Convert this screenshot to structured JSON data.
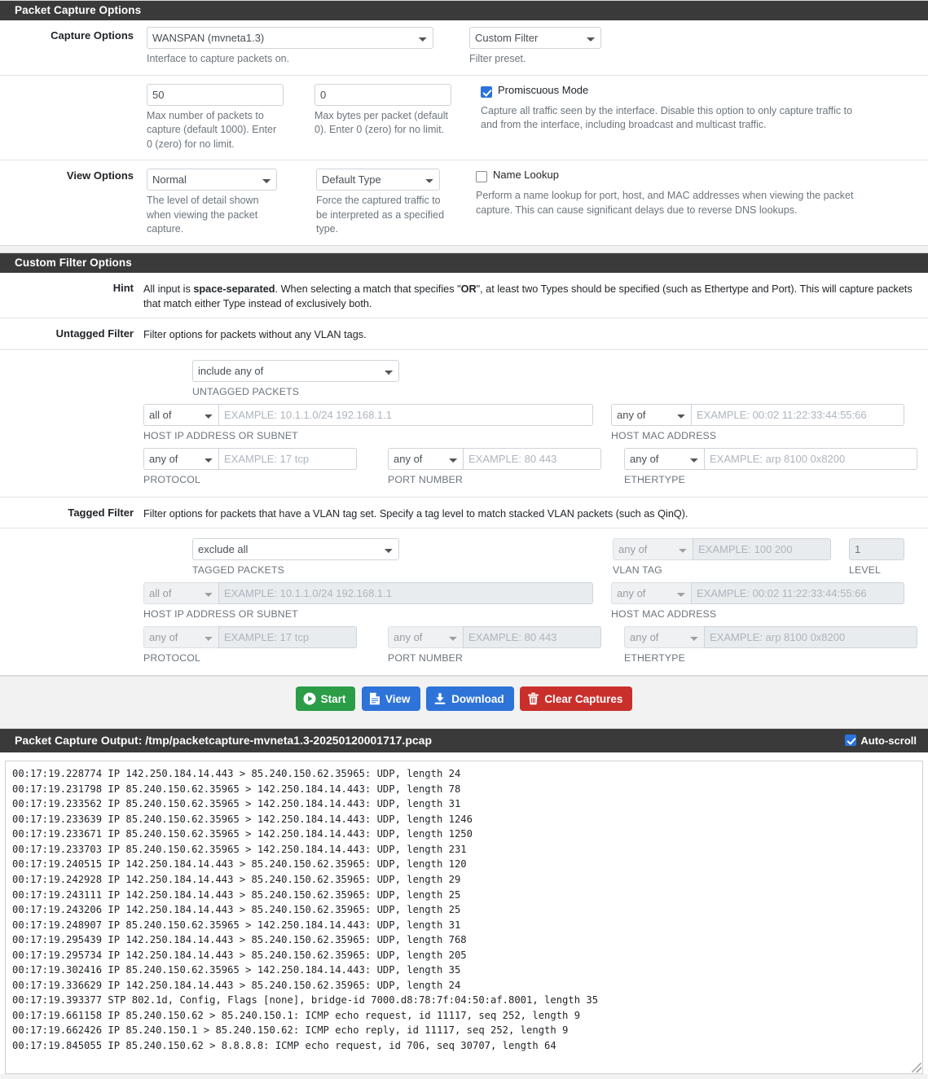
{
  "capture_panel": {
    "title": "Packet Capture Options",
    "capture_options_label": "Capture Options",
    "interface_value": "WANSPAN (mvneta1.3)",
    "interface_help": "Interface to capture packets on.",
    "filter_preset_value": "Custom Filter",
    "filter_preset_help": "Filter preset.",
    "max_packets_value": "50",
    "max_packets_help": "Max number of packets to capture (default 1000). Enter 0 (zero) for no limit.",
    "max_bytes_value": "0",
    "max_bytes_help": "Max bytes per packet (default 0). Enter 0 (zero) for no limit.",
    "promiscuous_label": "Promiscuous Mode",
    "promiscuous_checked": true,
    "promiscuous_help": "Capture all traffic seen by the interface. Disable this option to only capture traffic to and from the interface, including broadcast and multicast traffic.",
    "view_options_label": "View Options",
    "detail_level_value": "Normal",
    "detail_level_help": "The level of detail shown when viewing the packet capture.",
    "packet_type_value": "Default Type",
    "packet_type_help": "Force the captured traffic to be interpreted as a specified type.",
    "name_lookup_label": "Name Lookup",
    "name_lookup_checked": false,
    "name_lookup_help": "Perform a name lookup for port, host, and MAC addresses when viewing the packet capture. This can cause significant delays due to reverse DNS lookups."
  },
  "filter_panel": {
    "title": "Custom Filter Options",
    "hint_label": "Hint",
    "hint_part1": "All input is ",
    "hint_bold1": "space-separated",
    "hint_part2": ". When selecting a match that specifies \"",
    "hint_bold2": "OR",
    "hint_part3": "\", at least two Types should be specified (such as Ethertype and Port). This will capture packets that match either Type instead of exclusively both.",
    "untagged_label": "Untagged Filter",
    "untagged_desc": "Filter options for packets without any VLAN tags.",
    "tagged_label": "Tagged Filter",
    "tagged_desc": "Filter options for packets that have a VLAN tag set. Specify a tag level to match stacked VLAN packets (such as QinQ).",
    "untagged": {
      "mode_value": "include any of",
      "mode_caption": "UNTAGGED PACKETS",
      "host_ip_match": "all of",
      "host_ip_placeholder": "EXAMPLE: 10.1.1.0/24 192.168.1.1",
      "host_ip_caption": "HOST IP ADDRESS OR SUBNET",
      "host_mac_match": "any of",
      "host_mac_placeholder": "EXAMPLE: 00:02 11:22:33:44:55:66",
      "host_mac_caption": "HOST MAC ADDRESS",
      "protocol_match": "any of",
      "protocol_placeholder": "EXAMPLE: 17 tcp",
      "protocol_caption": "PROTOCOL",
      "port_match": "any of",
      "port_placeholder": "EXAMPLE: 80 443",
      "port_caption": "PORT NUMBER",
      "ethertype_match": "any of",
      "ethertype_placeholder": "EXAMPLE: arp 8100 0x8200",
      "ethertype_caption": "ETHERTYPE"
    },
    "tagged": {
      "mode_value": "exclude all",
      "mode_caption": "TAGGED PACKETS",
      "vlan_match": "any of",
      "vlan_placeholder": "EXAMPLE: 100 200",
      "vlan_caption": "VLAN TAG",
      "level_value": "1",
      "level_caption": "LEVEL",
      "host_ip_match": "all of",
      "host_ip_placeholder": "EXAMPLE: 10.1.1.0/24 192.168.1.1",
      "host_ip_caption": "HOST IP ADDRESS OR SUBNET",
      "host_mac_match": "any of",
      "host_mac_placeholder": "EXAMPLE: 00:02 11:22:33:44:55:66",
      "host_mac_caption": "HOST MAC ADDRESS",
      "protocol_match": "any of",
      "protocol_placeholder": "EXAMPLE: 17 tcp",
      "protocol_caption": "PROTOCOL",
      "port_match": "any of",
      "port_placeholder": "EXAMPLE: 80 443",
      "port_caption": "PORT NUMBER",
      "ethertype_match": "any of",
      "ethertype_placeholder": "EXAMPLE: arp 8100 0x8200",
      "ethertype_caption": "ETHERTYPE"
    }
  },
  "buttons": {
    "start": "Start",
    "view": "View",
    "download": "Download",
    "clear": "Clear Captures"
  },
  "output": {
    "title": "Packet Capture Output: /tmp/packetcapture-mvneta1.3-20250120001717.pcap",
    "autoscroll_label": "Auto-scroll",
    "autoscroll_checked": true,
    "lines": [
      "00:17:19.228774 IP 142.250.184.14.443 > 85.240.150.62.35965: UDP, length 24",
      "00:17:19.231798 IP 85.240.150.62.35965 > 142.250.184.14.443: UDP, length 78",
      "00:17:19.233562 IP 85.240.150.62.35965 > 142.250.184.14.443: UDP, length 31",
      "00:17:19.233639 IP 85.240.150.62.35965 > 142.250.184.14.443: UDP, length 1246",
      "00:17:19.233671 IP 85.240.150.62.35965 > 142.250.184.14.443: UDP, length 1250",
      "00:17:19.233703 IP 85.240.150.62.35965 > 142.250.184.14.443: UDP, length 231",
      "00:17:19.240515 IP 142.250.184.14.443 > 85.240.150.62.35965: UDP, length 120",
      "00:17:19.242928 IP 142.250.184.14.443 > 85.240.150.62.35965: UDP, length 29",
      "00:17:19.243111 IP 142.250.184.14.443 > 85.240.150.62.35965: UDP, length 25",
      "00:17:19.243206 IP 142.250.184.14.443 > 85.240.150.62.35965: UDP, length 25",
      "00:17:19.248907 IP 85.240.150.62.35965 > 142.250.184.14.443: UDP, length 31",
      "00:17:19.295439 IP 142.250.184.14.443 > 85.240.150.62.35965: UDP, length 768",
      "00:17:19.295734 IP 142.250.184.14.443 > 85.240.150.62.35965: UDP, length 205",
      "00:17:19.302416 IP 85.240.150.62.35965 > 142.250.184.14.443: UDP, length 35",
      "00:17:19.336629 IP 142.250.184.14.443 > 85.240.150.62.35965: UDP, length 24",
      "00:17:19.393377 STP 802.1d, Config, Flags [none], bridge-id 7000.d8:78:7f:04:50:af.8001, length 35",
      "00:17:19.661158 IP 85.240.150.62 > 85.240.150.1: ICMP echo request, id 11117, seq 252, length 9",
      "00:17:19.662426 IP 85.240.150.1 > 85.240.150.62: ICMP echo reply, id 11117, seq 252, length 9",
      "00:17:19.845055 IP 85.240.150.62 > 8.8.8.8: ICMP echo request, id 706, seq 30707, length 64"
    ]
  },
  "colors": {
    "header_bg": "#3a3a3a",
    "start_green": "#2a9d46",
    "blue": "#2e73d8",
    "red": "#c9302c",
    "checkbox_blue": "#2a72e0"
  }
}
